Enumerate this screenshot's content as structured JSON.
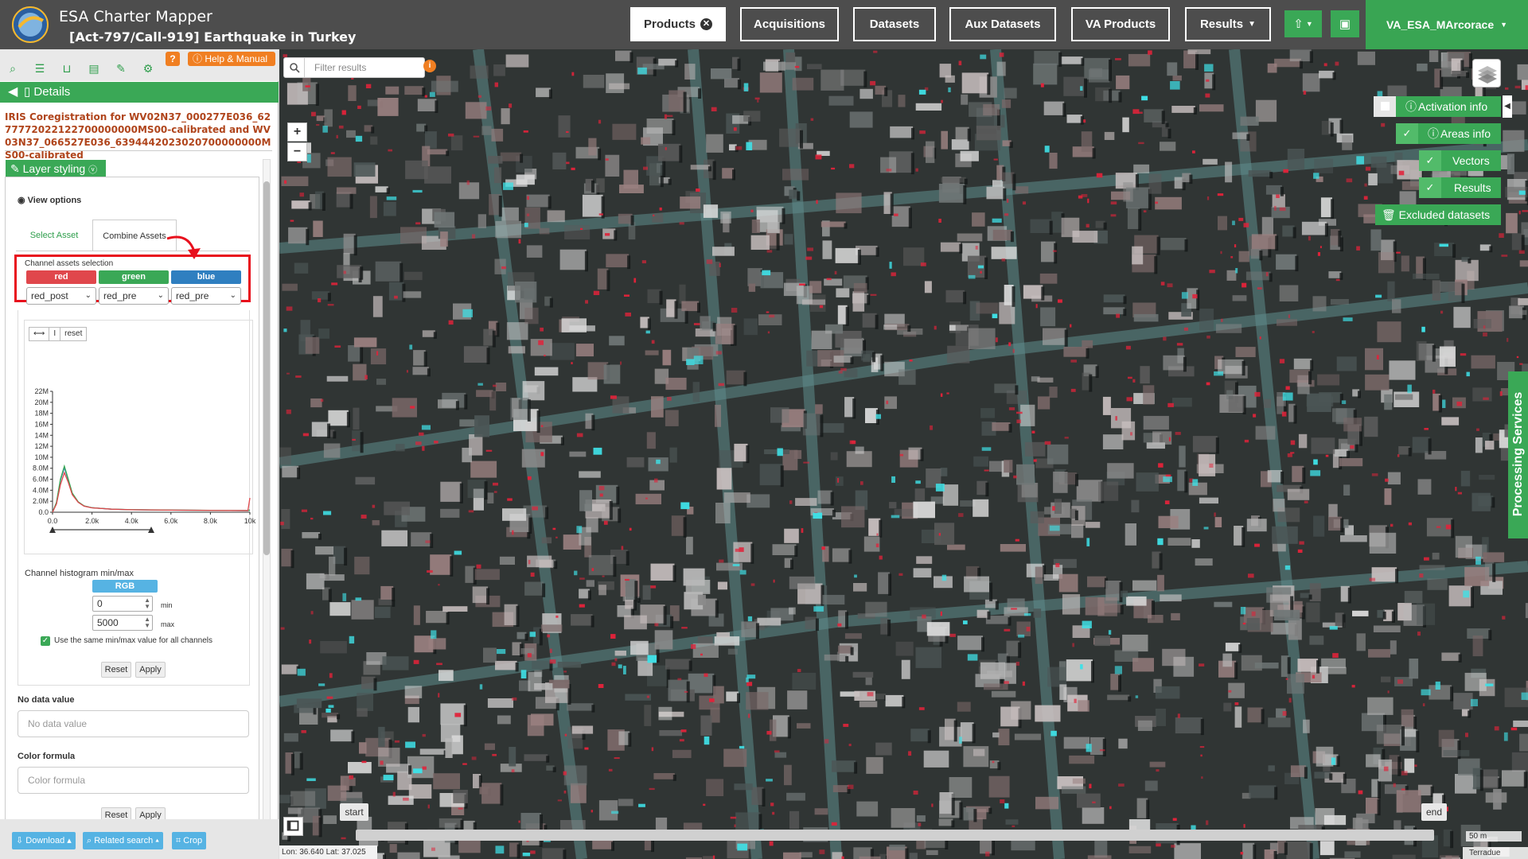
{
  "app": {
    "title": "ESA Charter Mapper",
    "activation": "[Act-797/Call-919] Earthquake in Turkey"
  },
  "nav": {
    "products": "Products",
    "acquisitions": "Acquisitions",
    "datasets": "Datasets",
    "aux_datasets": "Aux Datasets",
    "va_products": "VA Products",
    "results": "Results",
    "user": "VA_ESA_MArcorace"
  },
  "panel": {
    "help_q": "?",
    "help_manual": "Help & Manual",
    "details": "Details",
    "product_title": "IRIS Coregistration for WV02N37_000277E036_6277772022122700000000MS00-calibrated and WV03N37_066527E036_6394442023020700000000MS00-calibrated",
    "layer_styling": "Layer styling",
    "view_options": "View options",
    "tabs": {
      "select_asset": "Select Asset",
      "combine_assets": "Combine Assets"
    },
    "channel_assets_label": "Channel assets selection",
    "channels": [
      {
        "name": "red",
        "selected": "red_post",
        "color": "#e0474c"
      },
      {
        "name": "green",
        "selected": "red_pre",
        "color": "#3aa856"
      },
      {
        "name": "blue",
        "selected": "red_pre",
        "color": "#2f7fc0"
      }
    ],
    "histogram_tools": [
      "⟷",
      "I",
      "reset"
    ],
    "channel_minmax_label": "Channel histogram min/max",
    "rgb": "RGB",
    "min_value": "0",
    "max_value": "5000",
    "min_label": "min",
    "max_label": "max",
    "same_minmax": "Use the same min/max value for all channels",
    "reset": "Reset",
    "apply": "Apply",
    "no_data_label": "No data value",
    "no_data_placeholder": "No data value",
    "color_formula_label": "Color formula",
    "color_formula_placeholder": "Color formula",
    "download": "Download",
    "related_search": "Related search",
    "crop": "Crop"
  },
  "chart_data": {
    "type": "line",
    "x_ticks": [
      "0.0",
      "2.0k",
      "4.0k",
      "6.0k",
      "8.0k",
      "10k"
    ],
    "y_ticks": [
      "0.0",
      "2.0M",
      "4.0M",
      "6.0M",
      "8.0M",
      "10M",
      "12M",
      "14M",
      "16M",
      "18M",
      "20M",
      "22M"
    ],
    "xlim": [
      0,
      10000
    ],
    "ylim": [
      0,
      22000000
    ],
    "x": [
      0,
      200,
      400,
      600,
      800,
      1000,
      1300,
      1600,
      2000,
      3000,
      4000,
      6000,
      8000,
      9900,
      10000
    ],
    "series": [
      {
        "color": "#e0474c",
        "values": [
          0,
          1500000,
          5000000,
          7200000,
          5400000,
          3200000,
          1800000,
          1100000,
          800000,
          550000,
          450000,
          380000,
          330000,
          300000,
          2600000
        ]
      },
      {
        "color": "#3aa856",
        "values": [
          0,
          1800000,
          6000000,
          8400000,
          6000000,
          3500000,
          1900000,
          1150000,
          820000,
          560000,
          460000,
          390000,
          340000,
          300000,
          400000
        ]
      },
      {
        "color": "#2f7fc0",
        "values": [
          0,
          1700000,
          5800000,
          8100000,
          5800000,
          3400000,
          1850000,
          1120000,
          810000,
          555000,
          455000,
          385000,
          335000,
          300000,
          380000
        ]
      }
    ]
  },
  "map": {
    "filter_placeholder": "Filter results",
    "zoom_in": "+",
    "zoom_out": "−",
    "right_panel": {
      "activation_info": "Activation info",
      "areas_info": "Areas info",
      "vectors": "Vectors",
      "results": "Results",
      "excluded_datasets": "Excluded datasets"
    },
    "processing_services": "Processing Services",
    "timeline_start": "start",
    "timeline_end": "end",
    "coords": "Lon: 36.640 Lat: 37.025",
    "scale": "50 m",
    "attribution": "Terradue"
  }
}
